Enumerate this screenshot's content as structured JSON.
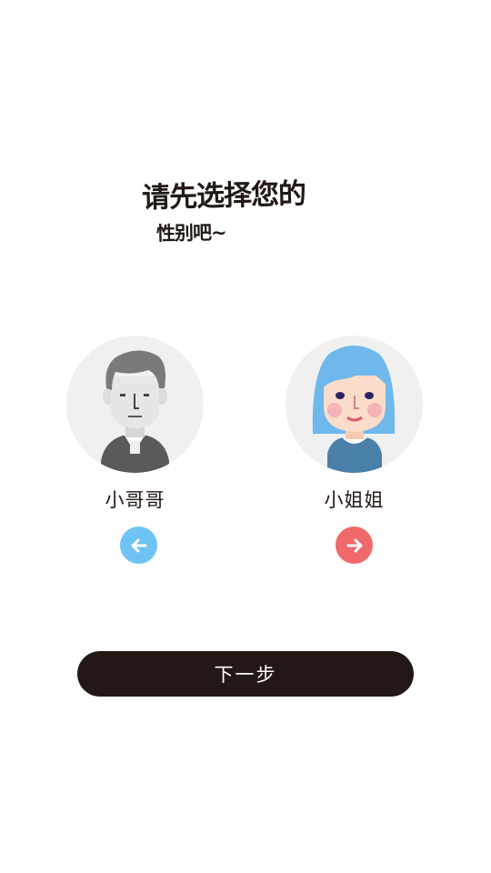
{
  "prompt": {
    "line1": "请先选择您的",
    "line2": "性别吧~"
  },
  "genders": [
    {
      "label": "小哥哥",
      "avatar_icon": "male-avatar-icon",
      "arrow_icon": "arrow-left-icon",
      "color": "#6ec3f4"
    },
    {
      "label": "小姐姐",
      "avatar_icon": "female-avatar-icon",
      "arrow_icon": "arrow-right-icon",
      "color": "#f0696a"
    }
  ],
  "actions": {
    "next_label": "下一步"
  },
  "colors": {
    "text": "#231815",
    "button_bg": "#231815",
    "avatar_bg": "#f0f0f0"
  }
}
